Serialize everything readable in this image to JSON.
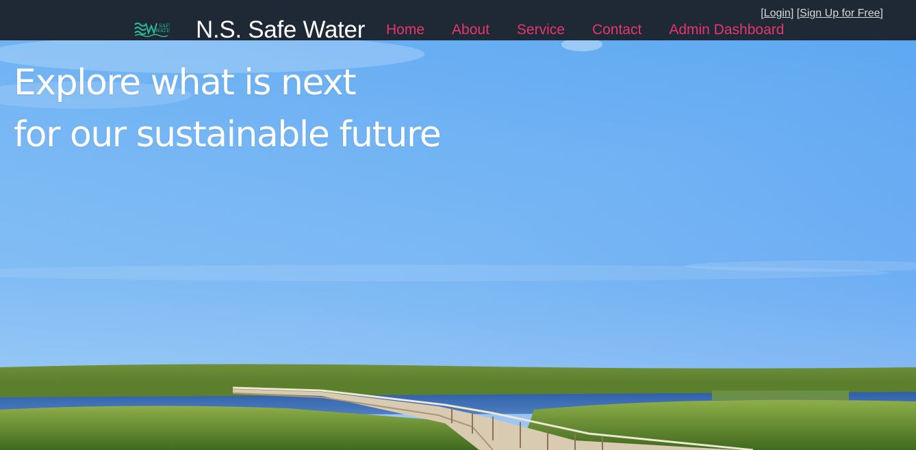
{
  "header": {
    "logo_text_top": "SAFE",
    "logo_text_bottom": "WATER",
    "title": "N.S. Safe Water",
    "nav": [
      {
        "label": "Home"
      },
      {
        "label": "About"
      },
      {
        "label": "Service"
      },
      {
        "label": "Contact"
      },
      {
        "label": "Admin Dashboard"
      }
    ],
    "auth": {
      "login_label": "[Login]",
      "signup_label": "[Sign Up for Free]"
    }
  },
  "hero": {
    "heading_line1": "Explore what is next",
    "heading_line2": "for our sustainable future",
    "image": "wetland-boardwalk-sky"
  },
  "colors": {
    "header_bg": "#1e2935",
    "nav_link": "#e8356f",
    "logo_accent": "#2bb89a",
    "title_text": "#ffffff"
  }
}
